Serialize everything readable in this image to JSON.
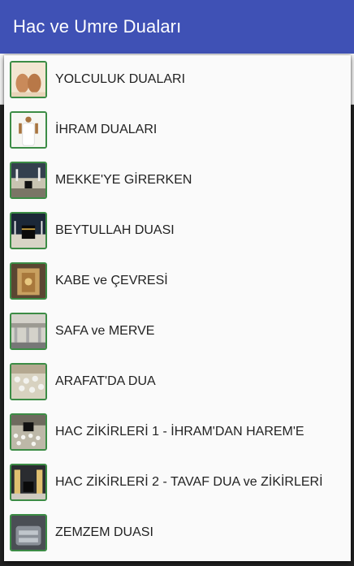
{
  "app": {
    "title": "Hac ve Umre Duaları"
  },
  "menu": {
    "items": [
      {
        "label": "YOLCULUK DUALARI",
        "icon": "hands-praying-icon"
      },
      {
        "label": "İHRAM DUALARI",
        "icon": "ihram-pilgrim-icon"
      },
      {
        "label": "MEKKE'YE GİRERKEN",
        "icon": "mecca-city-icon"
      },
      {
        "label": "BEYTULLAH DUASI",
        "icon": "kaaba-night-icon"
      },
      {
        "label": "KABE ve ÇEVRESİ",
        "icon": "kaaba-door-icon"
      },
      {
        "label": "SAFA ve MERVE",
        "icon": "safa-marwa-icon"
      },
      {
        "label": "ARAFAT'DA DUA",
        "icon": "arafat-crowd-icon"
      },
      {
        "label": "HAC ZİKİRLERİ 1 - İHRAM'DAN HAREM'E",
        "icon": "haram-crowd-icon"
      },
      {
        "label": "HAC ZİKİRLERİ 2 - TAVAF DUA ve ZİKİRLERİ",
        "icon": "tawaf-night-icon"
      },
      {
        "label": "ZEMZEM DUASI",
        "icon": "zamzam-well-icon"
      }
    ]
  },
  "colors": {
    "appbar": "#3f51b5",
    "thumb_border": "#3c8c45"
  }
}
